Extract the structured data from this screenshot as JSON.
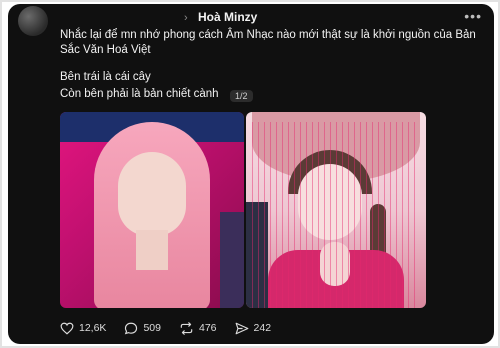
{
  "post": {
    "username": "Hoà Minzy",
    "text_line1": "Nhắc lại để mn nhớ phong cách Âm Nhạc nào mới thật sự là khởi nguồn của Bản Sắc Văn Hoá Việt",
    "text_line2": "Bên trái là cái cây",
    "text_line3": "Còn bên phải là bản chiết cành",
    "image_counter": "1/2"
  },
  "icons": {
    "chevron": "chevron-right-icon",
    "more": "more-icon",
    "like": "heart-icon",
    "comment": "comment-icon",
    "repost": "repost-icon",
    "share": "send-icon"
  },
  "actions": {
    "likes": "12,6K",
    "comments": "509",
    "reposts": "476",
    "shares": "242"
  },
  "colors": {
    "background": "#101010",
    "text": "#f3f3f3",
    "secondary": "#8a8a8a"
  }
}
